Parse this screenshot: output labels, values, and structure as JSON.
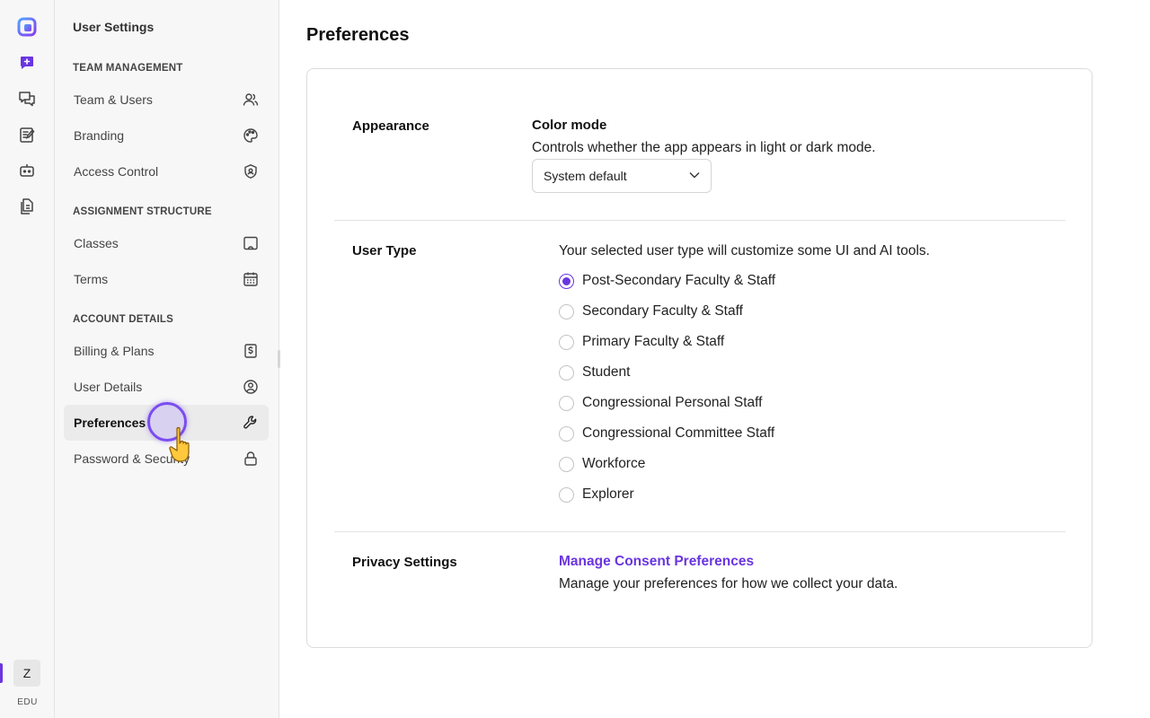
{
  "rail": {
    "icons": [
      "app-logo-icon",
      "new-chat-icon",
      "chats-icon",
      "notes-icon",
      "bot-icon",
      "documents-icon"
    ],
    "avatar_letter": "Z",
    "plan_label": "EDU",
    "accent": "#6a35e0"
  },
  "sidebar": {
    "title": "User Settings",
    "sections": [
      {
        "heading": "TEAM MANAGEMENT",
        "items": [
          {
            "label": "Team & Users",
            "icon": "users-icon"
          },
          {
            "label": "Branding",
            "icon": "palette-icon"
          },
          {
            "label": "Access Control",
            "icon": "shield-icon"
          }
        ]
      },
      {
        "heading": "ASSIGNMENT STRUCTURE",
        "items": [
          {
            "label": "Classes",
            "icon": "classroom-icon"
          },
          {
            "label": "Terms",
            "icon": "calendar-icon"
          }
        ]
      },
      {
        "heading": "ACCOUNT DETAILS",
        "items": [
          {
            "label": "Billing & Plans",
            "icon": "billing-icon"
          },
          {
            "label": "User Details",
            "icon": "user-circle-icon"
          },
          {
            "label": "Preferences",
            "icon": "wrench-icon",
            "active": true
          },
          {
            "label": "Password & Security",
            "icon": "lock-icon"
          }
        ]
      }
    ]
  },
  "main": {
    "title": "Preferences",
    "appearance": {
      "label": "Appearance",
      "color_mode_title": "Color mode",
      "color_mode_desc": "Controls whether the app appears in light or dark mode.",
      "selected": "System default"
    },
    "user_type": {
      "label": "User Type",
      "desc": "Your selected user type will customize some UI and AI tools.",
      "options": [
        "Post-Secondary Faculty & Staff",
        "Secondary Faculty & Staff",
        "Primary Faculty & Staff",
        "Student",
        "Congressional Personal Staff",
        "Congressional Committee Staff",
        "Workforce",
        "Explorer"
      ],
      "selected_index": 0
    },
    "privacy": {
      "label": "Privacy Settings",
      "link": "Manage Consent Preferences",
      "desc": "Manage your preferences for how we collect your data."
    }
  }
}
